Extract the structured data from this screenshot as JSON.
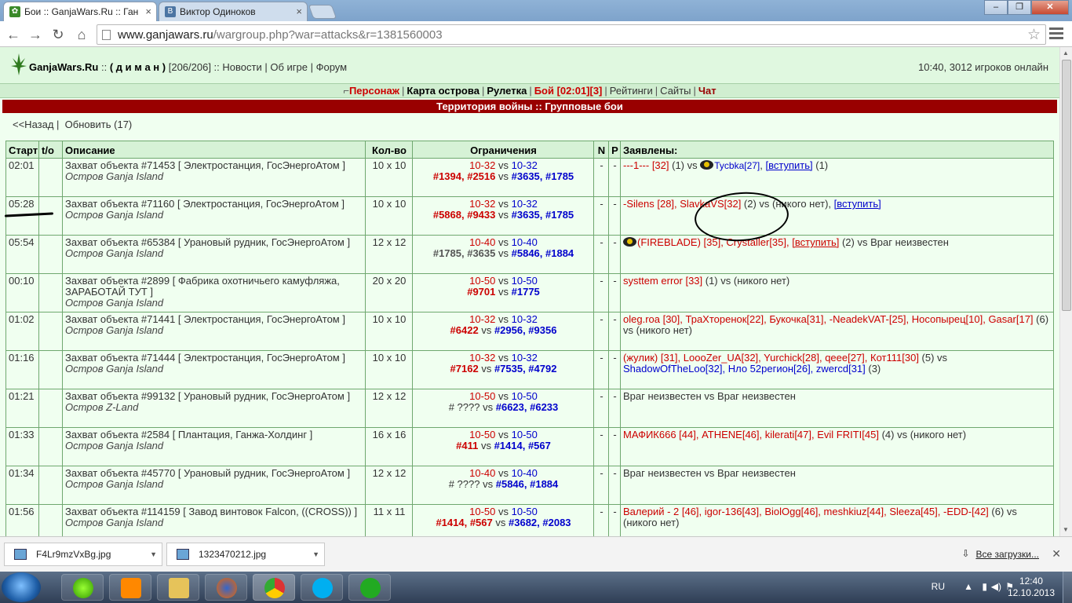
{
  "browser": {
    "tabs": [
      {
        "title": "Бои :: GanjaWars.Ru :: Ган",
        "favicon": "ganja-favicon",
        "active": true
      },
      {
        "title": "Виктор Одиноков",
        "favicon": "vk-favicon",
        "active": false
      }
    ],
    "url_host": "www.ganjawars.ru",
    "url_path": "/wargroup.php?war=attacks&r=1381560003",
    "window_min": "–",
    "window_max": "❐",
    "window_close": "✕"
  },
  "site": {
    "name": "GanjaWars.Ru",
    "sep1": " :: ",
    "user": "( д и м а н )",
    "hp": " [206/206] :: ",
    "nav_top": [
      "Новости",
      "Об игре",
      "Форум"
    ],
    "online": "10:40, 3012 игроков онлайн"
  },
  "mainnav": {
    "items": [
      {
        "label": "Персонаж",
        "style": "red"
      },
      {
        "label": "Карта острова",
        "style": "bold"
      },
      {
        "label": "Рулетка",
        "style": "bold"
      },
      {
        "label": "Бой [02:01][3]",
        "style": "red"
      },
      {
        "label": "Рейтинги",
        "style": "plain"
      },
      {
        "label": "Сайты",
        "style": "plain"
      },
      {
        "label": "Чат",
        "style": "redbold"
      }
    ]
  },
  "section_title": "Территория войны :: Групповые бои",
  "back_link": "<<Назад",
  "refresh_link": "Обновить (17)",
  "table": {
    "headers": [
      "Старт",
      "t/o",
      "Описание",
      "Кол-во",
      "Ограничения",
      "N",
      "P",
      "Заявлены:"
    ],
    "rows": [
      {
        "start": "02:01",
        "desc": "Захват объекта #71453 [ Электростанция, ГосЭнергоАтом ]",
        "loc": "Остров Ganja Island",
        "count": "10 x 10",
        "lim1": "10-32",
        "lim2": "10-32",
        "s1": "#1394, #2516",
        "s2": "#3635, #1785",
        "s1c": "rb",
        "n": "-",
        "p": "-"
      },
      {
        "start": "05:28",
        "desc": "Захват объекта #71160 [ Электростанция, ГосЭнергоАтом ]",
        "loc": "Остров Ganja Island",
        "count": "10 x 10",
        "lim1": "10-32",
        "lim2": "10-32",
        "s1": "#5868, #9433",
        "s2": "#3635, #1785",
        "s1c": "rb",
        "n": "-",
        "p": "-"
      },
      {
        "start": "05:54",
        "desc": "Захват объекта #65384 [ Урановый рудник, ГосЭнергоАтом ]",
        "loc": "Остров Ganja Island",
        "count": "12 x 12",
        "lim1": "10-40",
        "lim2": "10-40",
        "s1": "#1785, #3635",
        "s2": "#5846, #1884",
        "s1c": "gb",
        "n": "-",
        "p": "-"
      },
      {
        "start": "00:10",
        "desc": "Захват объекта #2899 [ Фабрика охотничьего камуфляжа, ЗАРАБОТАЙ ТУТ ]",
        "loc": "Остров Ganja Island",
        "count": "20 x 20",
        "lim1": "10-50",
        "lim2": "10-50",
        "s1": "#9701",
        "s2": "#1775",
        "s1c": "rb",
        "n": "-",
        "p": "-"
      },
      {
        "start": "01:02",
        "desc": "Захват объекта #71441 [ Электростанция, ГосЭнергоАтом ]",
        "loc": "Остров Ganja Island",
        "count": "10 x 10",
        "lim1": "10-32",
        "lim2": "10-32",
        "s1": "#6422",
        "s2": "#2956, #9356",
        "s1c": "rb",
        "n": "-",
        "p": "-"
      },
      {
        "start": "01:16",
        "desc": "Захват объекта #71444 [ Электростанция, ГосЭнергоАтом ]",
        "loc": "Остров Ganja Island",
        "count": "10 x 10",
        "lim1": "10-32",
        "lim2": "10-32",
        "s1": "#7162",
        "s2": "#7535, #4792",
        "s1c": "rb",
        "n": "-",
        "p": "-"
      },
      {
        "start": "01:21",
        "desc": "Захват объекта #99132 [ Урановый рудник, ГосЭнергоАтом ]",
        "loc": "Остров Z-Land",
        "count": "12 x 12",
        "lim1": "10-50",
        "lim2": "10-50",
        "s1": "# ????",
        "s2": "#6623, #6233",
        "s1c": "plain",
        "n": "-",
        "p": "-"
      },
      {
        "start": "01:33",
        "desc": "Захват объекта #2584 [ Плантация, Ганжа-Холдинг ]",
        "loc": "Остров Ganja Island",
        "count": "16 x 16",
        "lim1": "10-50",
        "lim2": "10-50",
        "s1": "#411",
        "s2": "#1414, #567",
        "s1c": "rb",
        "n": "-",
        "p": "-"
      },
      {
        "start": "01:34",
        "desc": "Захват объекта #45770 [ Урановый рудник, ГосЭнергоАтом ]",
        "loc": "Остров Ganja Island",
        "count": "12 x 12",
        "lim1": "10-40",
        "lim2": "10-40",
        "s1": "# ????",
        "s2": "#5846, #1884",
        "s1c": "plain",
        "n": "-",
        "p": "-"
      },
      {
        "start": "01:56",
        "desc": "Захват объекта #114159 [ Завод винтовок Falcon, ((CROSS)) ]",
        "loc": "Остров Ganja Island",
        "count": "11 x 11",
        "lim1": "10-50",
        "lim2": "10-50",
        "s1": "#1414, #567",
        "s2": "#3682, #2083",
        "s1c": "rb",
        "n": "-",
        "p": "-"
      }
    ],
    "vs": "vs",
    "join": "[вступить]",
    "reg": [
      {
        "a": "---1--- [32]",
        "b": " (1) vs ",
        "c": "Tycbka[27]",
        "d": ", ",
        "e": "[вступить]",
        "f": " (1)"
      },
      {
        "a": "-Silens [28], SlavkaVS[32]",
        "b": " (2) vs (никого нет), ",
        "c": "[вступить]"
      },
      {
        "a": "(FIREBLADE) [35], Crystaller[35], ",
        "b": "[вступить]",
        "c": " (2) vs Враг неизвестен"
      },
      {
        "a": "systtem error [33]",
        "b": " (1) vs (никого нет)"
      },
      {
        "a": "oleg.roa [30], ТраХторенок[22], Букочка[31], -NeadekVAT-[25], Носопырец[10], Gasar[17]",
        "b": " (6) vs (никого нет)"
      },
      {
        "a": "(жулик) [31], LoooZer_UA[32], Yurchick[28], qeee[27], Кот111[30]",
        "b": " (5) vs ",
        "c": "ShadowOfTheLoo[32], Нло 52регион[26], zwercd[31]",
        "d": " (3)"
      },
      {
        "a": "Враг неизвестен vs Враг неизвестен"
      },
      {
        "a": "МАФИК666 [44], ATHENE[46], kilerati[47], Evil FRITI[45]",
        "b": " (4) vs (никого нет)"
      },
      {
        "a": "Враг неизвестен vs Враг неизвестен"
      },
      {
        "a": "Валерий - 2 [46], igor-136[43], BiolOgg[46], meshkiuz[44], Sleeza[45], -EDD-[42]",
        "b": " (6) vs (никого нет)"
      }
    ]
  },
  "downloads": {
    "items": [
      "F4Lr9mzVxBg.jpg",
      "1323470212.jpg"
    ],
    "all_label": "Все загрузки...",
    "close": "✕"
  },
  "taskbar": {
    "lang": "RU",
    "time": "12:40",
    "date": "12.10.2013"
  },
  "colors": {
    "accent_red": "#990000",
    "page_bg": "#f0fff0",
    "link_blue": "#0000cc"
  }
}
